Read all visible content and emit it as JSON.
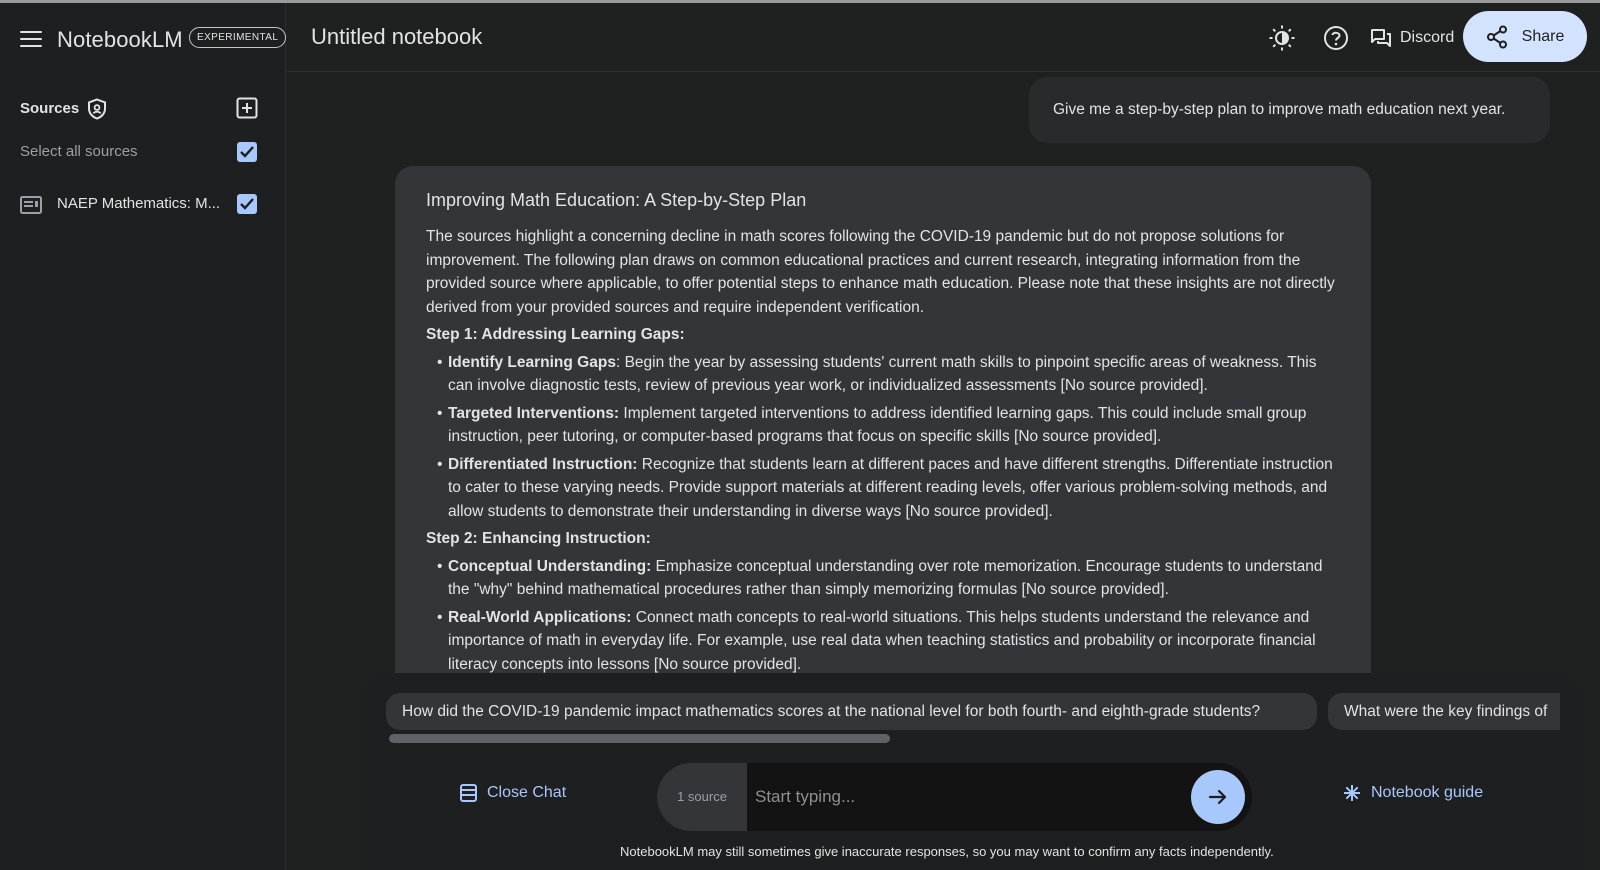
{
  "app": {
    "name": "NotebookLM",
    "badge": "EXPERIMENTAL",
    "notebook_title": "Untitled notebook"
  },
  "header": {
    "discord_label": "Discord",
    "share_label": "Share",
    "icons": [
      "menu-icon",
      "theme-toggle-icon",
      "help-icon",
      "discord-icon",
      "share-icon"
    ]
  },
  "sidebar": {
    "sources_title": "Sources",
    "select_all_label": "Select all sources",
    "select_all_checked": true,
    "sources": [
      {
        "name": "NAEP Mathematics: M...",
        "checked": true
      }
    ]
  },
  "chat": {
    "user_message": "Give me a step-by-step plan to improve math education next year.",
    "response": {
      "title": "Improving Math Education: A Step-by-Step Plan",
      "intro": "The sources highlight a concerning decline in math scores following the COVID-19 pandemic but do not propose solutions for improvement. The following plan draws on common educational practices and current research, integrating information from the provided source where applicable, to offer potential steps to enhance math education. Please note that these insights are not directly derived from your provided sources and require independent verification.",
      "steps": [
        {
          "heading": "Step 1: Addressing Learning Gaps:",
          "bullets": [
            {
              "term": "Identify Learning Gaps",
              "text": ": Begin the year by assessing students' current math skills to pinpoint specific areas of weakness. This can involve diagnostic tests, review of previous year work, or individualized assessments [No source provided]."
            },
            {
              "term": "Targeted Interventions:",
              "text": " Implement targeted interventions to address identified learning gaps. This could include small group instruction, peer tutoring, or computer-based programs that focus on specific skills [No source provided]."
            },
            {
              "term": "Differentiated Instruction:",
              "text": " Recognize that students learn at different paces and have different strengths. Differentiate instruction to cater to these varying needs. Provide support materials at different reading levels, offer various problem-solving methods, and allow students to demonstrate their understanding in diverse ways [No source provided]."
            }
          ]
        },
        {
          "heading": "Step 2: Enhancing Instruction:",
          "bullets": [
            {
              "term": "Conceptual Understanding:",
              "text": " Emphasize conceptual understanding over rote memorization. Encourage students to understand the \"why\" behind mathematical procedures rather than simply memorizing formulas [No source provided]."
            },
            {
              "term": "Real-World Applications:",
              "text": " Connect math concepts to real-world situations. This helps students understand the relevance and importance of math in everyday life. For example, use real data when teaching statistics and probability or incorporate financial literacy concepts into lessons [No source provided]."
            }
          ]
        }
      ]
    },
    "suggestions": [
      "How did the COVID-19 pandemic impact mathematics scores at the national level for both fourth- and eighth-grade students?",
      "What were the key findings of"
    ]
  },
  "footer": {
    "close_chat_label": "Close Chat",
    "source_count": "1 source",
    "input_placeholder": "Start typing...",
    "notebook_guide_label": "Notebook guide",
    "disclaimer": "NotebookLM may still sometimes give inaccurate responses, so you may want to confirm any facts independently."
  },
  "colors": {
    "background": "#1f2020",
    "accent": "#a8c7fa",
    "share_bg": "#d3e3fd",
    "card": "#333538"
  }
}
